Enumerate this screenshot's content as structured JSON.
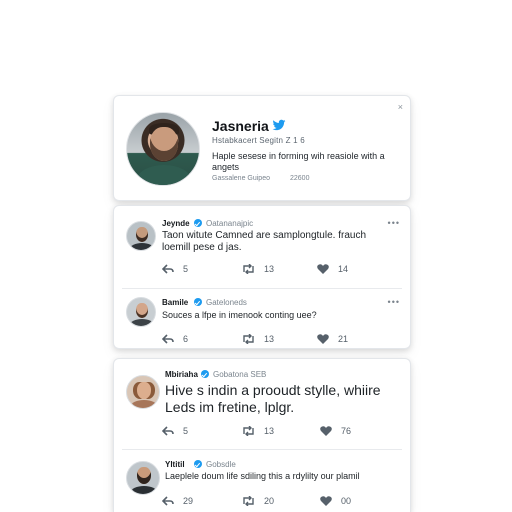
{
  "profile": {
    "name": "Jasneria",
    "meta": "Hstabkacert Segitn Z 1 6",
    "bio": "Haple sesese in forming wih reasiole with a angets",
    "handle": "Gassalene Guipeo",
    "count": "22600",
    "close_label": "×",
    "verified_icon": "twitter-bird-icon",
    "accent": "#1d9bf0"
  },
  "tweets": [
    {
      "name": "Jeynde",
      "handle": "Oatananajpic",
      "text_line1": "Taon witute Camned are samplongtule. frauch",
      "text_line2": "loemill pese d jas.",
      "more": "•••",
      "reply_count": "5",
      "retweet_count": "13",
      "like_count": "14"
    },
    {
      "name": "Bamile",
      "handle": "Gateloneds",
      "text_line1": "Souces a lfpe in imenook conting uee?",
      "text_line2": "",
      "more": "•••",
      "reply_count": "6",
      "retweet_count": "13",
      "like_count": "21"
    },
    {
      "name": "Mbiriaha",
      "handle": "Gobatona SEB",
      "text_line1": "Hive s indin a prooudt stylle, whiire",
      "text_line2": "Leds im fretine, lplgr.",
      "more": "",
      "reply_count": "5",
      "retweet_count": "13",
      "like_count": "76"
    },
    {
      "name": "Yltitil",
      "handle": "Gobsdle",
      "text_line1": "Laeplele doum life sdiling this a rdylilty our plamil",
      "text_line2": "",
      "more": "",
      "reply_count": "29",
      "retweet_count": "20",
      "like_count": "00"
    }
  ],
  "icons": {
    "reply": "reply-icon",
    "retweet": "retweet-icon",
    "like": "heart-icon",
    "more": "more-options-icon",
    "verified": "verified-badge-icon"
  }
}
